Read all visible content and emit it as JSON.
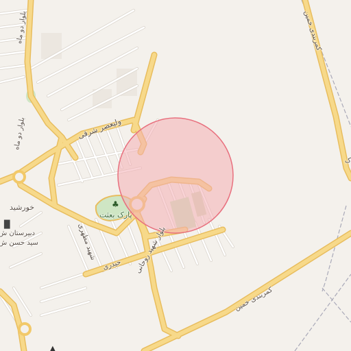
{
  "map": {
    "colors": {
      "background": "#f4f1ec",
      "road_fill": "#f7d98a",
      "road_casing": "#e8bd5e",
      "minor_road": "#ffffff",
      "minor_casing": "#d9d3cb",
      "park": "#cfe6c4",
      "railway": "#a9a9b8",
      "highlight_fill": "#f4aeb5",
      "highlight_stroke": "#e8707e"
    },
    "labels": {
      "blvd_nw": "بلوار دو ماه",
      "blvd_w": "بلوار دو ماه",
      "valiasr": "ولیعصر شرقی",
      "khorshid": "خورشید",
      "park_besat": "پارک بعثت",
      "school": "دبیرستان ش",
      "school2": "سید حسن ش",
      "shahid_rohani": "بلوار شهید روحانی",
      "shahid_mottahari": "شهید مطهری",
      "heydari": "حیدری",
      "kamarbandi_top": "کمربندی خمین",
      "kamarbandi_bottom": "کمربندی خمین",
      "right_edge": "ک"
    },
    "icons": {
      "park": "tree-icon",
      "school": "school-icon",
      "bottom_poi": "graduation-cap-icon"
    }
  }
}
